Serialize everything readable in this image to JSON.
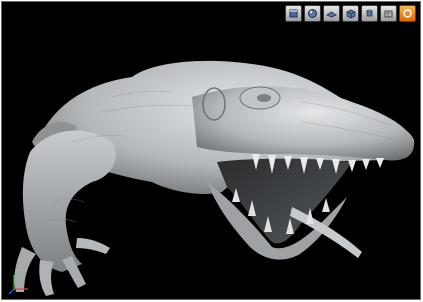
{
  "toolbar": {
    "buttons": [
      {
        "icon": "shaded-cube-icon"
      },
      {
        "icon": "sphere-icon"
      },
      {
        "icon": "flat-plane-icon"
      },
      {
        "icon": "box-view-icon"
      },
      {
        "icon": "cylinder-icon"
      },
      {
        "icon": "wireframe-box-icon"
      },
      {
        "icon": "rotate-orbit-icon",
        "active": true
      }
    ]
  },
  "viewport": {
    "model": "sculpted-reptile-model",
    "background": "#000000",
    "accent": "#f08a1c"
  }
}
